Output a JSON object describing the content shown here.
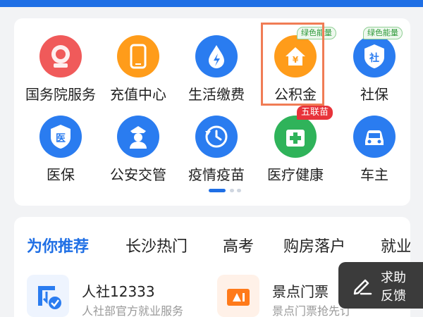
{
  "colors": {
    "accent": "#1f6fe5",
    "highlight": "#f07c55",
    "badge_green": "#2f9a3a",
    "badge_red": "#e8333a"
  },
  "services": [
    {
      "label": "国务院服务",
      "icon": "state-council-emblem-icon",
      "color": "#f05a5a"
    },
    {
      "label": "充值中心",
      "icon": "phone-recharge-icon",
      "color": "#ff9c1a"
    },
    {
      "label": "生活缴费",
      "icon": "utility-drop-bolt-icon",
      "color": "#2a7cf0"
    },
    {
      "label": "公积金",
      "icon": "housing-fund-house-yen-icon",
      "color": "#ff9c1a",
      "badge": "绿色能量"
    },
    {
      "label": "社保",
      "icon": "social-security-shield-icon",
      "color": "#2a7cf0",
      "badge": "绿色能量"
    },
    {
      "label": "医保",
      "icon": "medical-insurance-shield-icon",
      "color": "#2a7cf0"
    },
    {
      "label": "公安交管",
      "icon": "police-officer-icon",
      "color": "#2a7cf0"
    },
    {
      "label": "疫情疫苗",
      "icon": "vaccine-clock-icon",
      "color": "#2a7cf0"
    },
    {
      "label": "医疗健康",
      "icon": "medical-cross-icon",
      "color": "#2fb35a",
      "badge": "五联苗"
    },
    {
      "label": "车主",
      "icon": "car-icon",
      "color": "#2a7cf0"
    }
  ],
  "tabs": [
    "为你推荐",
    "长沙热门",
    "高考",
    "购房落户",
    "就业"
  ],
  "recommendations": [
    {
      "title": "人社12333",
      "subtitle": "人社部官方就业服务",
      "icon": "hr-download-check-icon",
      "color": "#2a7cf0"
    },
    {
      "title": "景点门票",
      "subtitle": "景点门票抢先订",
      "icon": "ticket-icon",
      "color": "#ff7a1a"
    }
  ],
  "help_button": {
    "line1": "求助",
    "line2": "反馈",
    "icon": "pen-edit-icon"
  }
}
